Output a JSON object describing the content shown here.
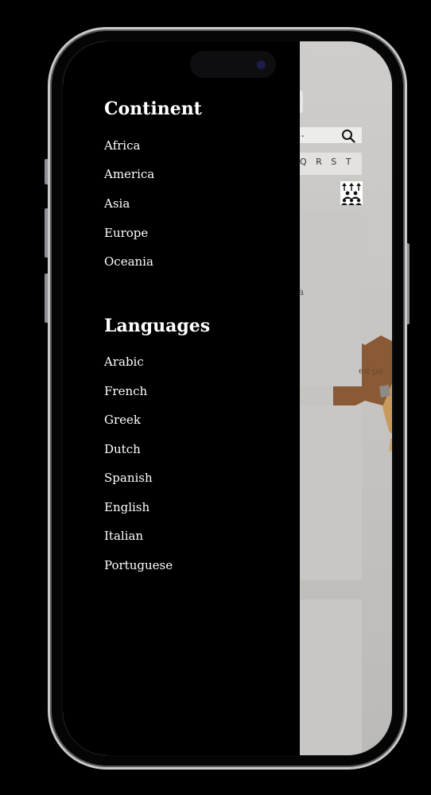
{
  "background_app": {
    "search_placeholder": "ch...",
    "alphabet_index": "Q R S T",
    "card_fragment": "a",
    "map_label": "ed·pa"
  },
  "drawer": {
    "continent_title": "Continent",
    "continents": [
      "Africa",
      "America",
      "Asia",
      "Europe",
      "Oceania"
    ],
    "languages_title": "Languages",
    "languages": [
      "Arabic",
      "French",
      "Greek",
      "Dutch",
      "Spanish",
      "English",
      "Italian",
      "Portuguese"
    ]
  }
}
